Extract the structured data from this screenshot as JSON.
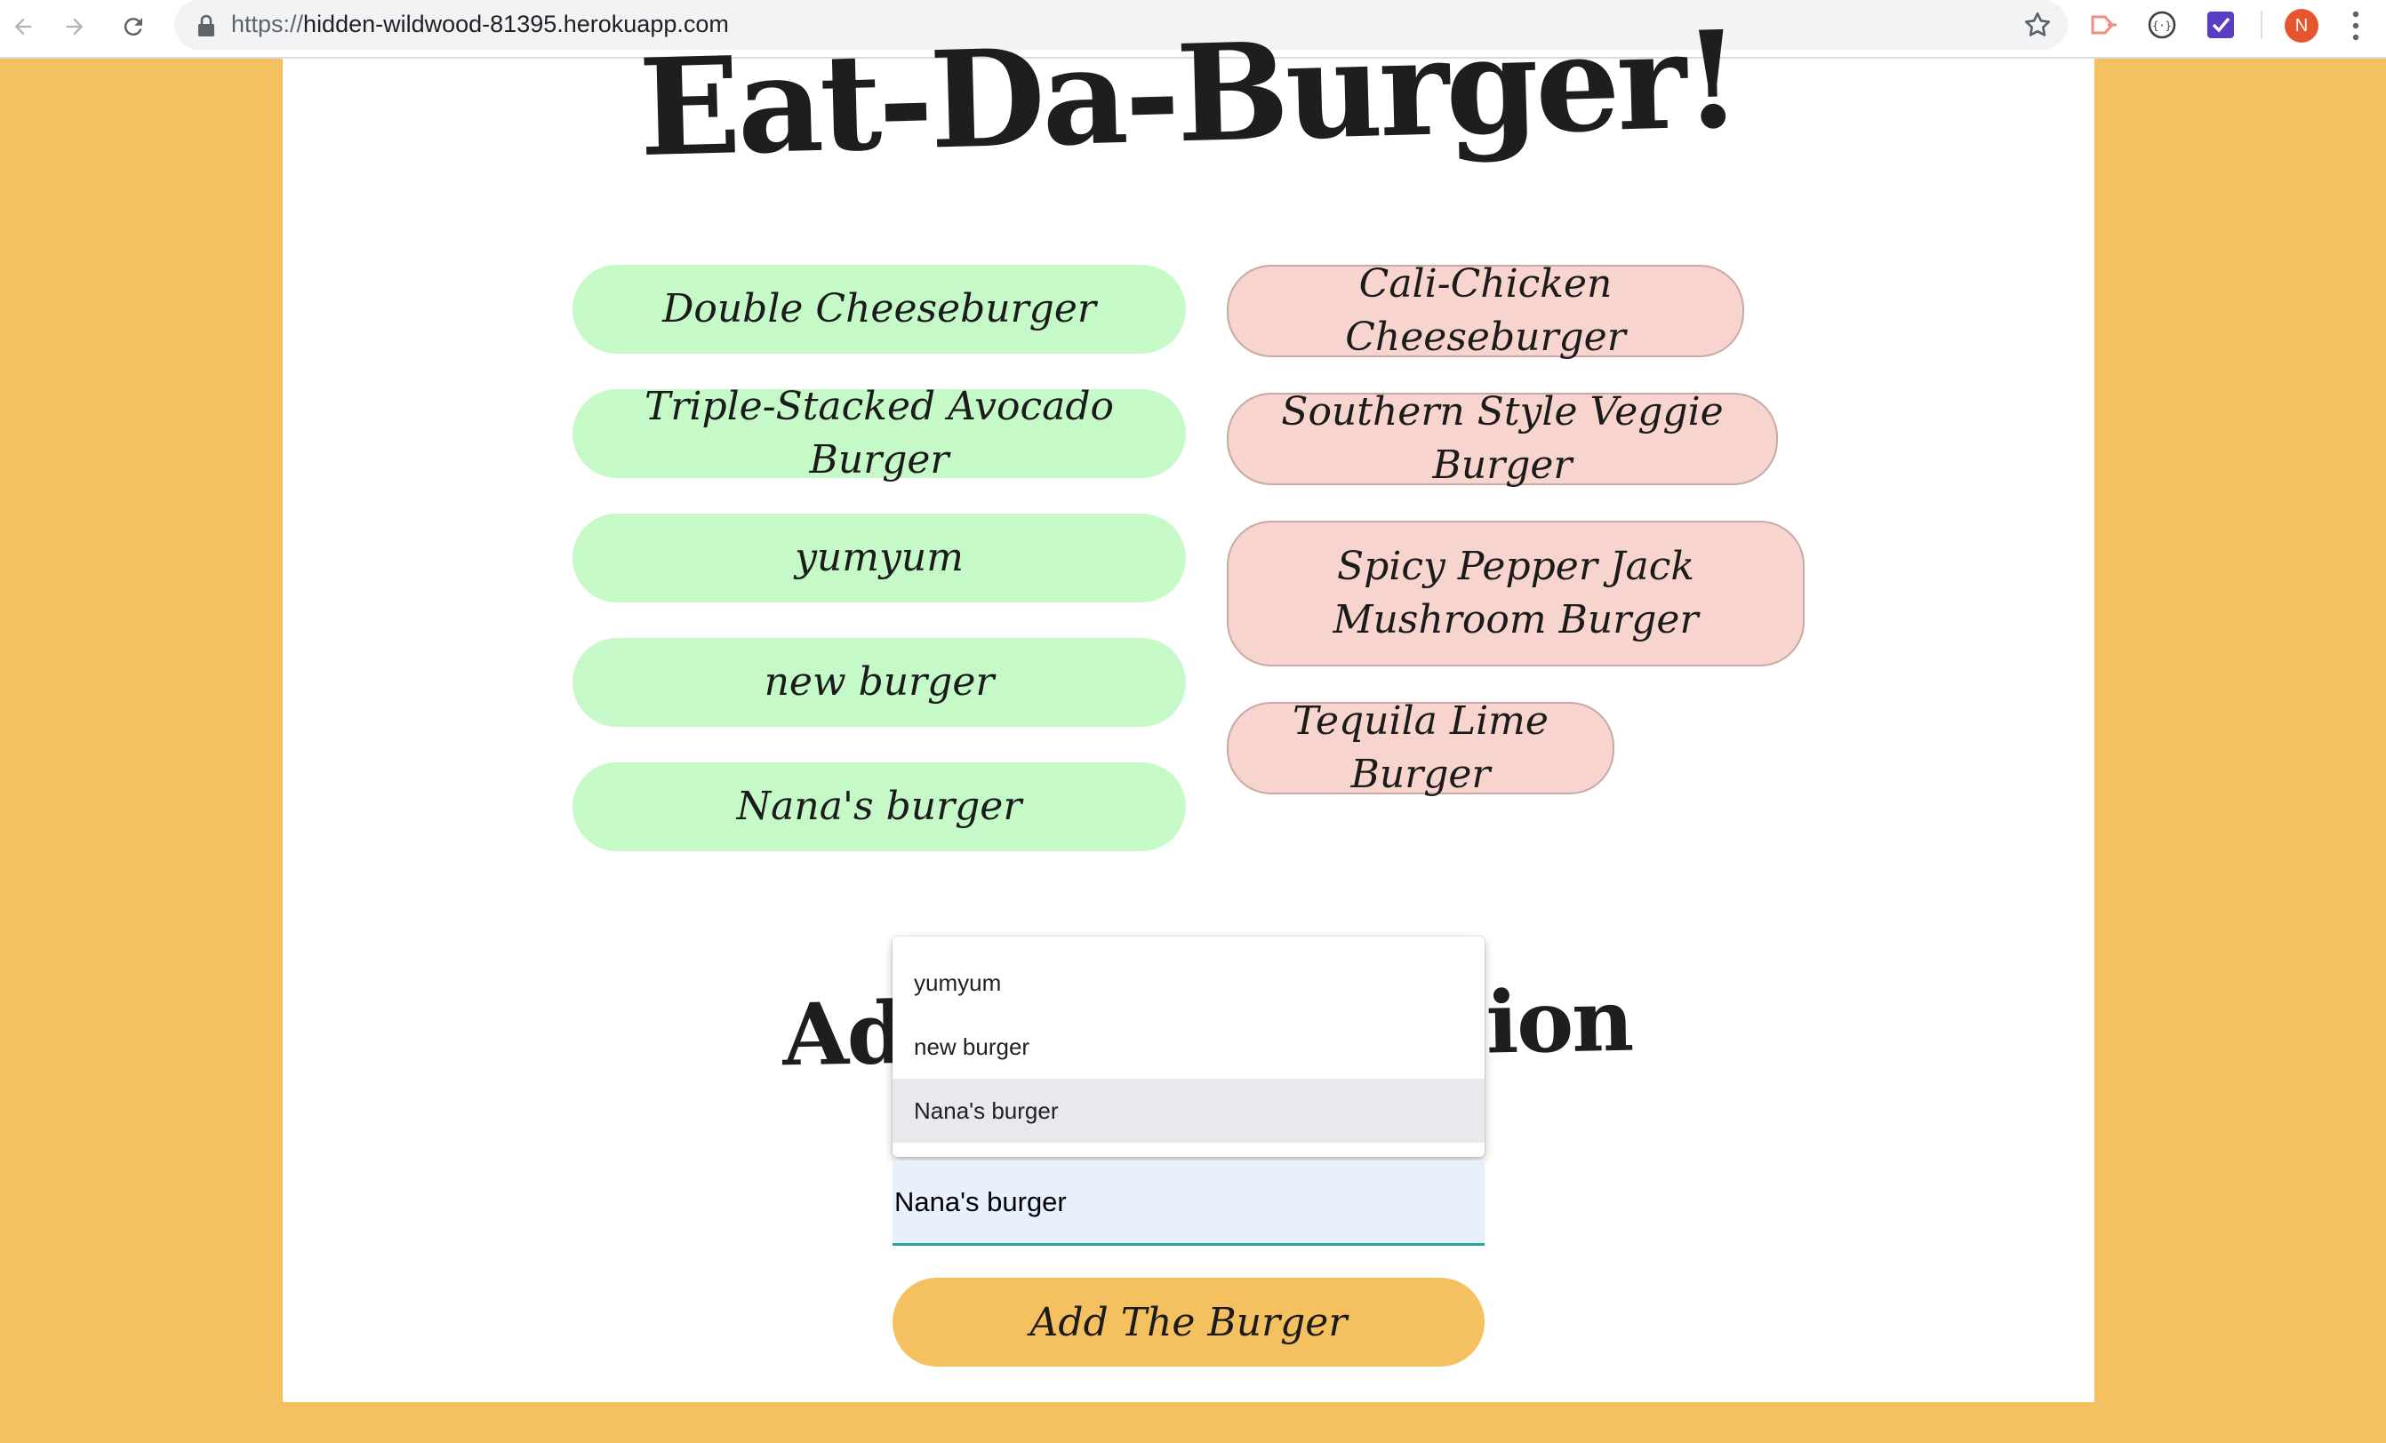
{
  "browser": {
    "url_protocol": "https://",
    "url_host": "hidden-wildwood-81395.herokuapp.com",
    "profile_initial": "N"
  },
  "page": {
    "title": "Eat-Da-Burger!",
    "eaten_burgers": [
      "Double Cheeseburger",
      "Triple-Stacked Avocado Burger",
      "yumyum",
      "new burger",
      "Nana's burger"
    ],
    "burgers_to_devour": [
      "Cali-Chicken Cheeseburger",
      "Southern Style Veggie Burger",
      "Spicy Pepper Jack Mushroom Burger",
      "Tequila Lime Burger"
    ],
    "add_section_title_left": "Ad",
    "add_section_title_right": "ion",
    "input_value": "Nana's burger",
    "add_button_label": "Add The Burger"
  },
  "autocomplete": {
    "options": [
      "yumyum",
      "new burger",
      "Nana's burger"
    ],
    "highlighted": "Nana's burger"
  },
  "colors": {
    "background": "#f5c05f",
    "eaten": "#c5f9c7",
    "devour": "#f8d4ce",
    "input_underline": "#26a69a"
  }
}
